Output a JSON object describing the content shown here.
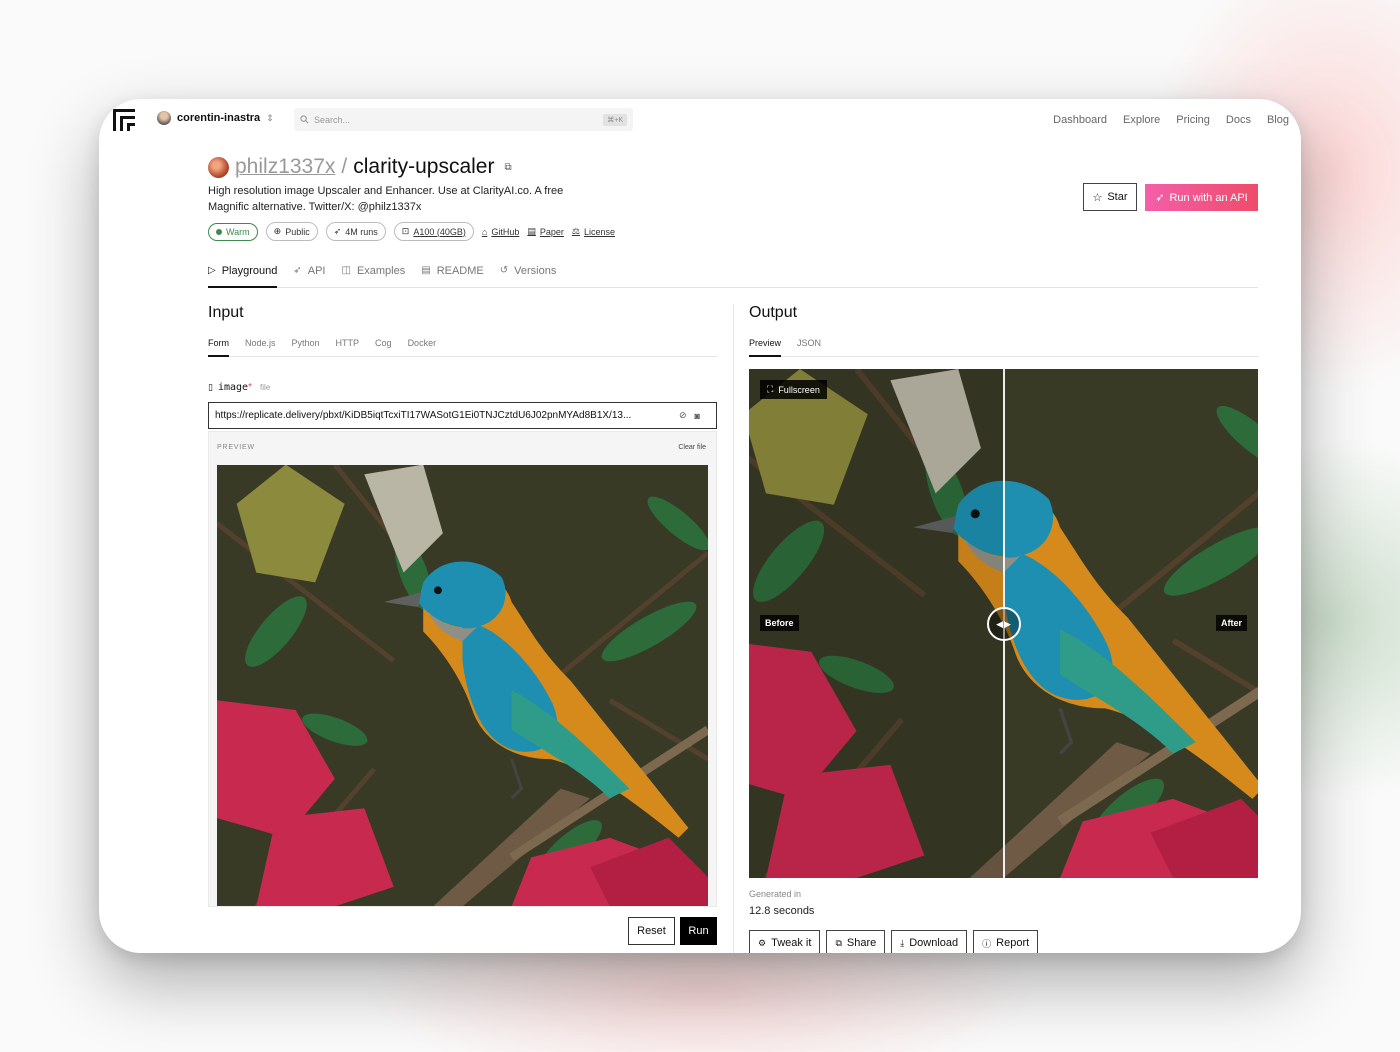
{
  "topbar": {
    "account_name": "corentin-inastra",
    "search_placeholder": "Search...",
    "search_shortcut": "⌘+K",
    "nav": [
      "Dashboard",
      "Explore",
      "Pricing",
      "Docs",
      "Blog"
    ]
  },
  "model": {
    "owner": "philz1337x",
    "separator": "/",
    "name": "clarity-upscaler",
    "description": "High resolution image Upscaler and Enhancer. Use at ClarityAI.co. A free Magnific alternative. Twitter/X: @philz1337x",
    "badges": {
      "status": "Warm",
      "visibility": "Public",
      "runs": "4M runs",
      "hardware": "A100 (40GB)"
    },
    "links": {
      "github": "GitHub",
      "paper": "Paper",
      "license": "License"
    },
    "star_label": "Star",
    "api_label": "Run with an API"
  },
  "tabs": [
    "Playground",
    "API",
    "Examples",
    "README",
    "Versions"
  ],
  "input": {
    "title": "Input",
    "subtabs": [
      "Form",
      "Node.js",
      "Python",
      "HTTP",
      "Cog",
      "Docker"
    ],
    "field": {
      "name": "image",
      "required_mark": "*",
      "type": "file",
      "value": "https://replicate.delivery/pbxt/KiDB5iqtTcxiTI17WASotG1Ei0TNJCztdU6J02pnMYAd8B1X/13..."
    },
    "preview_label": "PREVIEW",
    "clear_label": "Clear file",
    "reset_label": "Reset",
    "run_label": "Run"
  },
  "output": {
    "title": "Output",
    "subtabs": [
      "Preview",
      "JSON"
    ],
    "fullscreen_label": "Fullscreen",
    "before_label": "Before",
    "after_label": "After",
    "generated_label": "Generated in",
    "generated_value": "12.8 seconds",
    "actions": [
      "Tweak it",
      "Share",
      "Download",
      "Report"
    ]
  },
  "colors": {
    "accent_pink": "#f35fa9",
    "accent_red": "#ef4c6a",
    "warm_green": "#3e8a4e",
    "bird_teal": "#1e8fb0",
    "bird_orange": "#d68a1c",
    "leaf_red": "#c8294f"
  },
  "icons": {
    "logo": "replicate-logo",
    "search": "search-icon",
    "copy": "copy-icon",
    "globe": "globe-icon",
    "rocket": "rocket-icon",
    "chip": "chip-icon",
    "github": "github-icon",
    "paper": "document-icon",
    "license": "scale-icon",
    "star": "star-icon",
    "play": "play-icon",
    "file": "file-icon",
    "link": "link-icon",
    "camera": "camera-icon",
    "compare": "compare-arrows-icon"
  }
}
